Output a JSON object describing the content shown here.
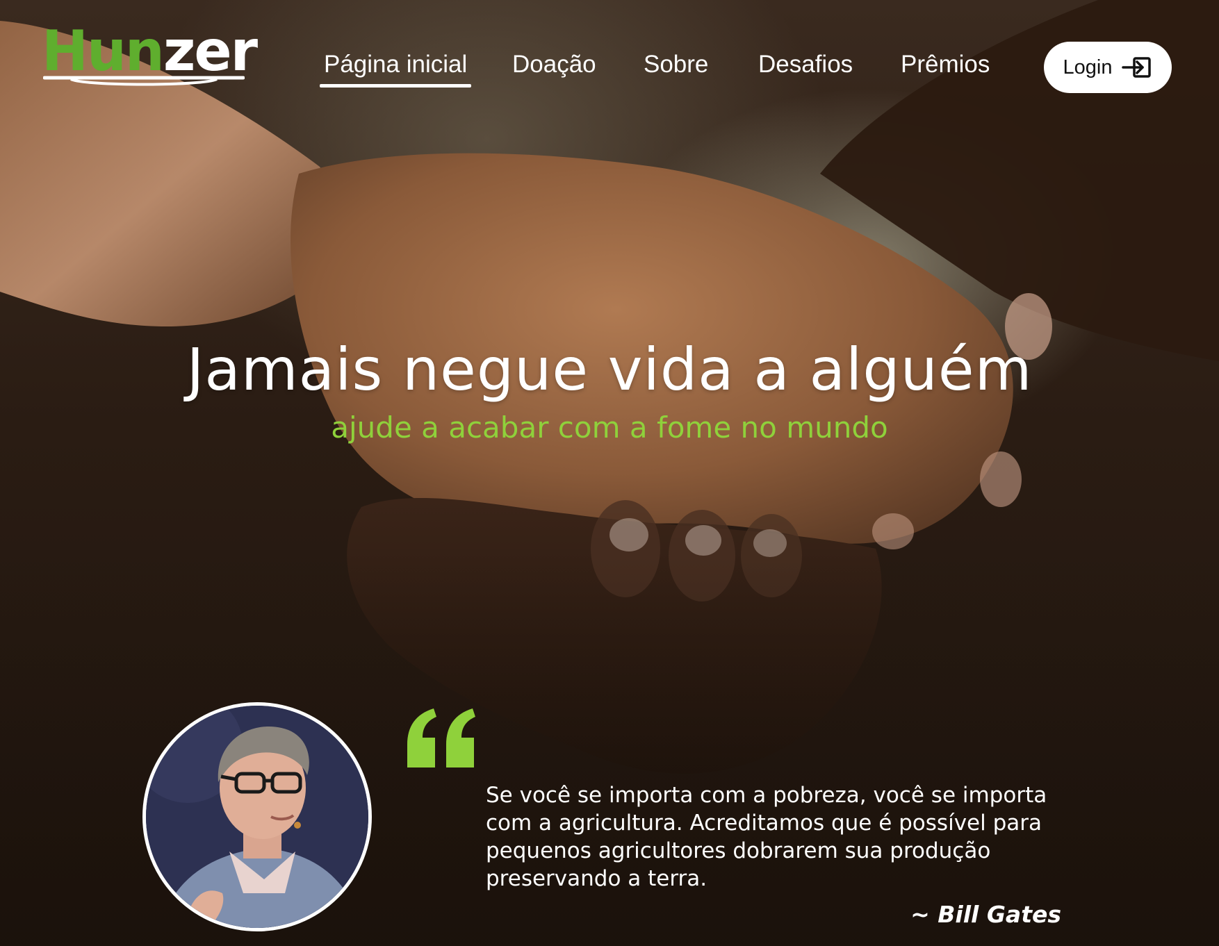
{
  "logo": {
    "part_green": "Hun",
    "part_white": "zer"
  },
  "nav": {
    "items": [
      {
        "label": "Página inicial",
        "active": true
      },
      {
        "label": "Doação"
      },
      {
        "label": "Sobre"
      },
      {
        "label": "Desafios"
      },
      {
        "label": "Prêmios"
      }
    ],
    "login_label": "Login"
  },
  "hero": {
    "headline": "Jamais negue vida a alguém",
    "subheadline": "ajude a acabar com a fome no mundo"
  },
  "testimonial": {
    "quote": "Se você se importa com a pobreza, você se importa com a agricultura. Acreditamos que é possível para pequenos agricultores dobrarem sua produção preservando a terra.",
    "author": "~ Bill Gates"
  },
  "colors": {
    "accent_green": "#8fd13b",
    "logo_green": "#5fae2e",
    "text_light": "#ffffff",
    "background_dark": "#1d130d"
  },
  "icons": {
    "login": "login-arrow-icon",
    "quote": "quote-icon"
  }
}
